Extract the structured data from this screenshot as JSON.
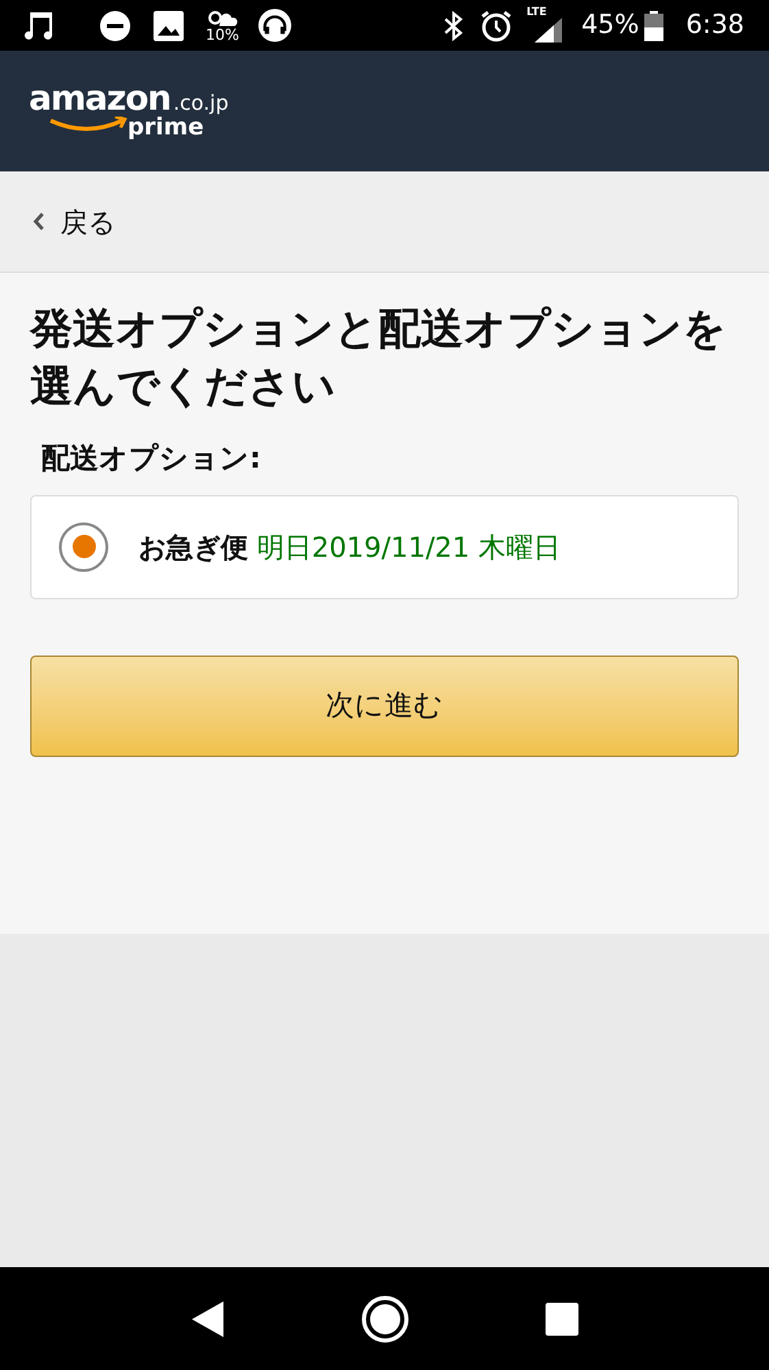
{
  "status_bar": {
    "weather_text": "10%",
    "network": "LTE",
    "battery": "45%",
    "time": "6:38"
  },
  "header": {
    "logo": {
      "word": "amazon",
      "domain": ".co.jp",
      "sub": "prime"
    }
  },
  "back": {
    "label": "戻る"
  },
  "title": "発送オプションと配送オプションを選んでください",
  "section_label": "配送オプション:",
  "options": [
    {
      "name": "お急ぎ便",
      "date": "明日2019/11/21 木曜日",
      "selected": true
    }
  ],
  "continue_button": "次に進む"
}
